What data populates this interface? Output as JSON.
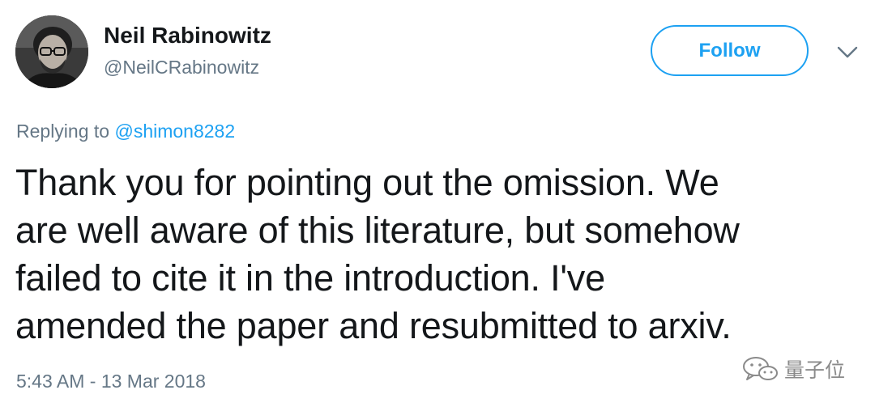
{
  "tweet": {
    "author": {
      "display_name": "Neil Rabinowitz",
      "handle": "@NeilCRabinowitz"
    },
    "follow_label": "Follow",
    "replying": {
      "prefix": "Replying to ",
      "mention": "@shimon8282"
    },
    "text_lines": [
      "Thank you for pointing out the omission. We",
      "are well aware of this literature, but somehow",
      "failed to cite it in the introduction. I've",
      "amended the paper and resubmitted to arxiv."
    ],
    "timestamp": "5:43 AM - 13 Mar 2018"
  },
  "watermark": {
    "text": "量子位",
    "icon": "wechat-icon"
  },
  "colors": {
    "accent": "#1da1f2",
    "text": "#14171a",
    "secondary": "#657786"
  }
}
